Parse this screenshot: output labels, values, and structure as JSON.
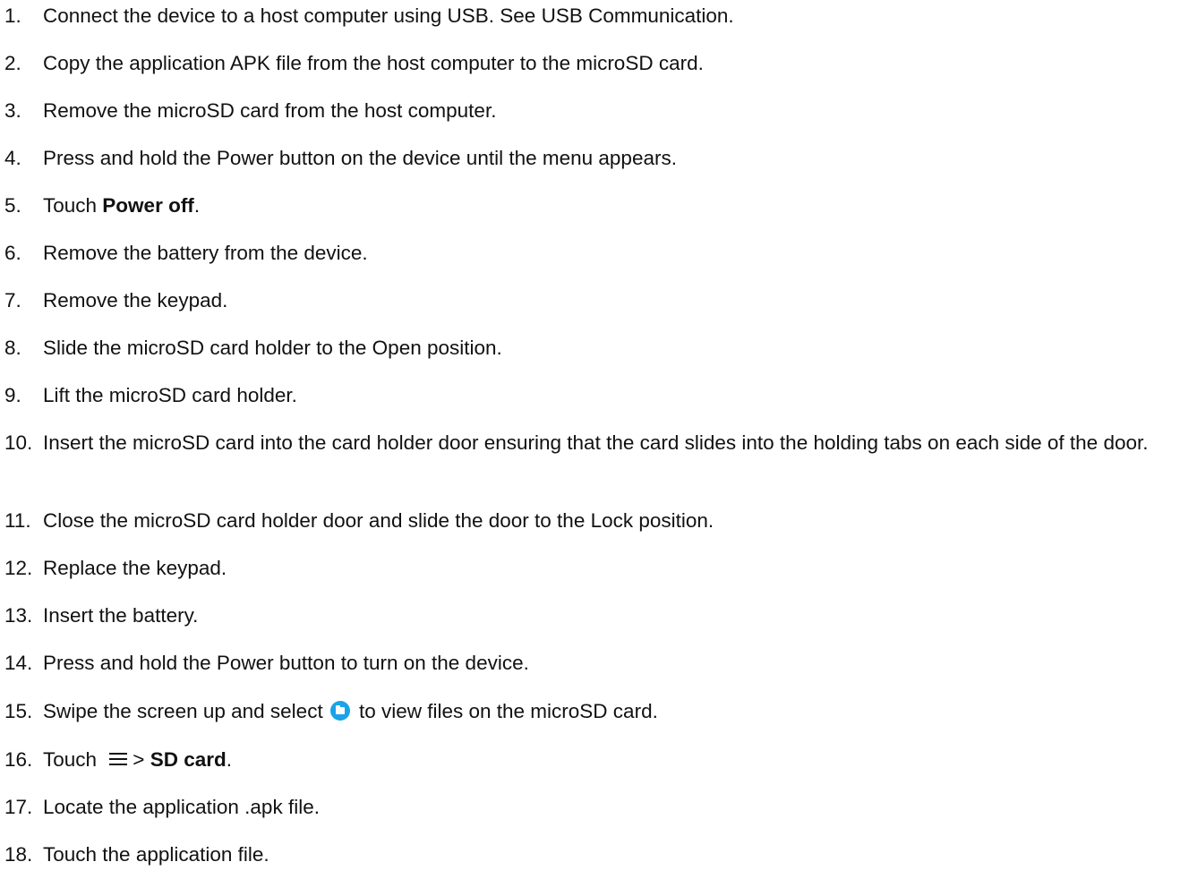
{
  "steps": [
    {
      "num": "1.",
      "text": "Connect the device to a host computer using USB. See USB Communication."
    },
    {
      "num": "2.",
      "text": "Copy the application APK file from the host computer to the microSD card."
    },
    {
      "num": "3.",
      "text": "Remove the microSD card from the host computer."
    },
    {
      "num": "4.",
      "text": "Press and hold the Power button on the device until the menu appears."
    },
    {
      "num": "5.",
      "pre": "Touch ",
      "bold": "Power off",
      "post": "."
    },
    {
      "num": "6.",
      "text": "Remove the battery from the device."
    },
    {
      "num": "7.",
      "text": "Remove the keypad."
    },
    {
      "num": "8.",
      "text": "Slide the microSD card holder to the Open position."
    },
    {
      "num": "9.",
      "text": "Lift the microSD card holder."
    },
    {
      "num": "10.",
      "text": "Insert the microSD card into the card holder door ensuring that the card slides into the holding tabs on each side of the door."
    },
    {
      "num": "11.",
      "text": "Close the microSD card holder door and slide the door to the Lock position."
    },
    {
      "num": "12.",
      "text": "Replace the keypad."
    },
    {
      "num": "13.",
      "text": "Insert the battery."
    },
    {
      "num": "14.",
      "text": "Press and hold the Power button to turn on the device."
    },
    {
      "num": "15.",
      "pre": "Swipe the screen up and select ",
      "icon": "folder-icon",
      "post": "to view files on the microSD card."
    },
    {
      "num": "16.",
      "pre": "Touch ",
      "icon": "menu-icon",
      "mid": "> ",
      "bold": "SD card",
      "post": "."
    },
    {
      "num": "17.",
      "text": "Locate the application .apk file."
    },
    {
      "num": "18.",
      "text": "Touch the application file."
    }
  ],
  "colors": {
    "text": "#111111",
    "folder_icon": "#1aa3e8"
  }
}
